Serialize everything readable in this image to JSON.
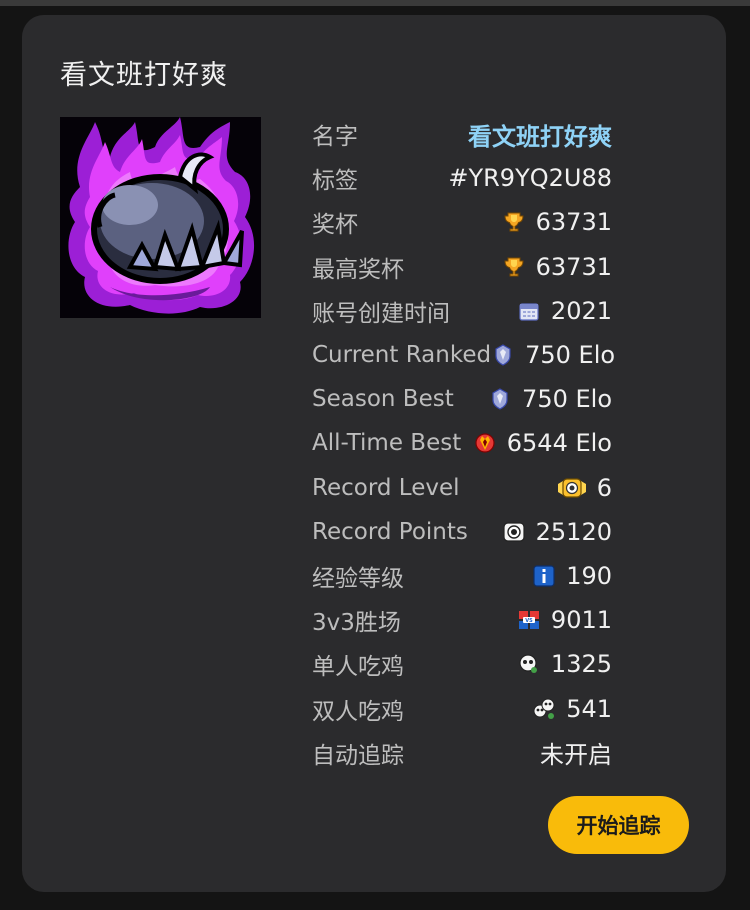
{
  "player": {
    "title": "看文班打好爽",
    "avatar_icon": "skull-fist-purple-flame-icon",
    "rows": [
      {
        "label": "名字",
        "value": "看文班打好爽",
        "icon": null
      },
      {
        "label": "标签",
        "value": "#YR9YQ2U88",
        "icon": null
      },
      {
        "label": "奖杯",
        "value": "63731",
        "icon": "trophy-icon"
      },
      {
        "label": "最高奖杯",
        "value": "63731",
        "icon": "trophy-icon"
      },
      {
        "label": "账号创建时间",
        "value": "2021",
        "icon": "calendar-icon"
      },
      {
        "label": "Current Ranked",
        "value": "750 Elo",
        "icon": "ranked-silver-icon"
      },
      {
        "label": "Season Best",
        "value": "750 Elo",
        "icon": "ranked-silver-icon"
      },
      {
        "label": "All-Time Best",
        "value": "6544 Elo",
        "icon": "ranked-red-icon"
      },
      {
        "label": "Record Level",
        "value": "6",
        "icon": "record-level-icon"
      },
      {
        "label": "Record Points",
        "value": "25120",
        "icon": "record-points-icon"
      },
      {
        "label": "经验等级",
        "value": "190",
        "icon": "experience-icon"
      },
      {
        "label": "3v3胜场",
        "value": "9011",
        "icon": "3v3-icon"
      },
      {
        "label": "单人吃鸡",
        "value": "1325",
        "icon": "solo-showdown-icon"
      },
      {
        "label": "双人吃鸡",
        "value": "541",
        "icon": "duo-showdown-icon"
      },
      {
        "label": "自动追踪",
        "value": "未开启",
        "icon": null
      }
    ],
    "button_label": "开始追踪",
    "colors": {
      "accent": "#f9bb0a",
      "name_link": "#8fd3f7",
      "card_bg": "#2b2b2d"
    }
  }
}
